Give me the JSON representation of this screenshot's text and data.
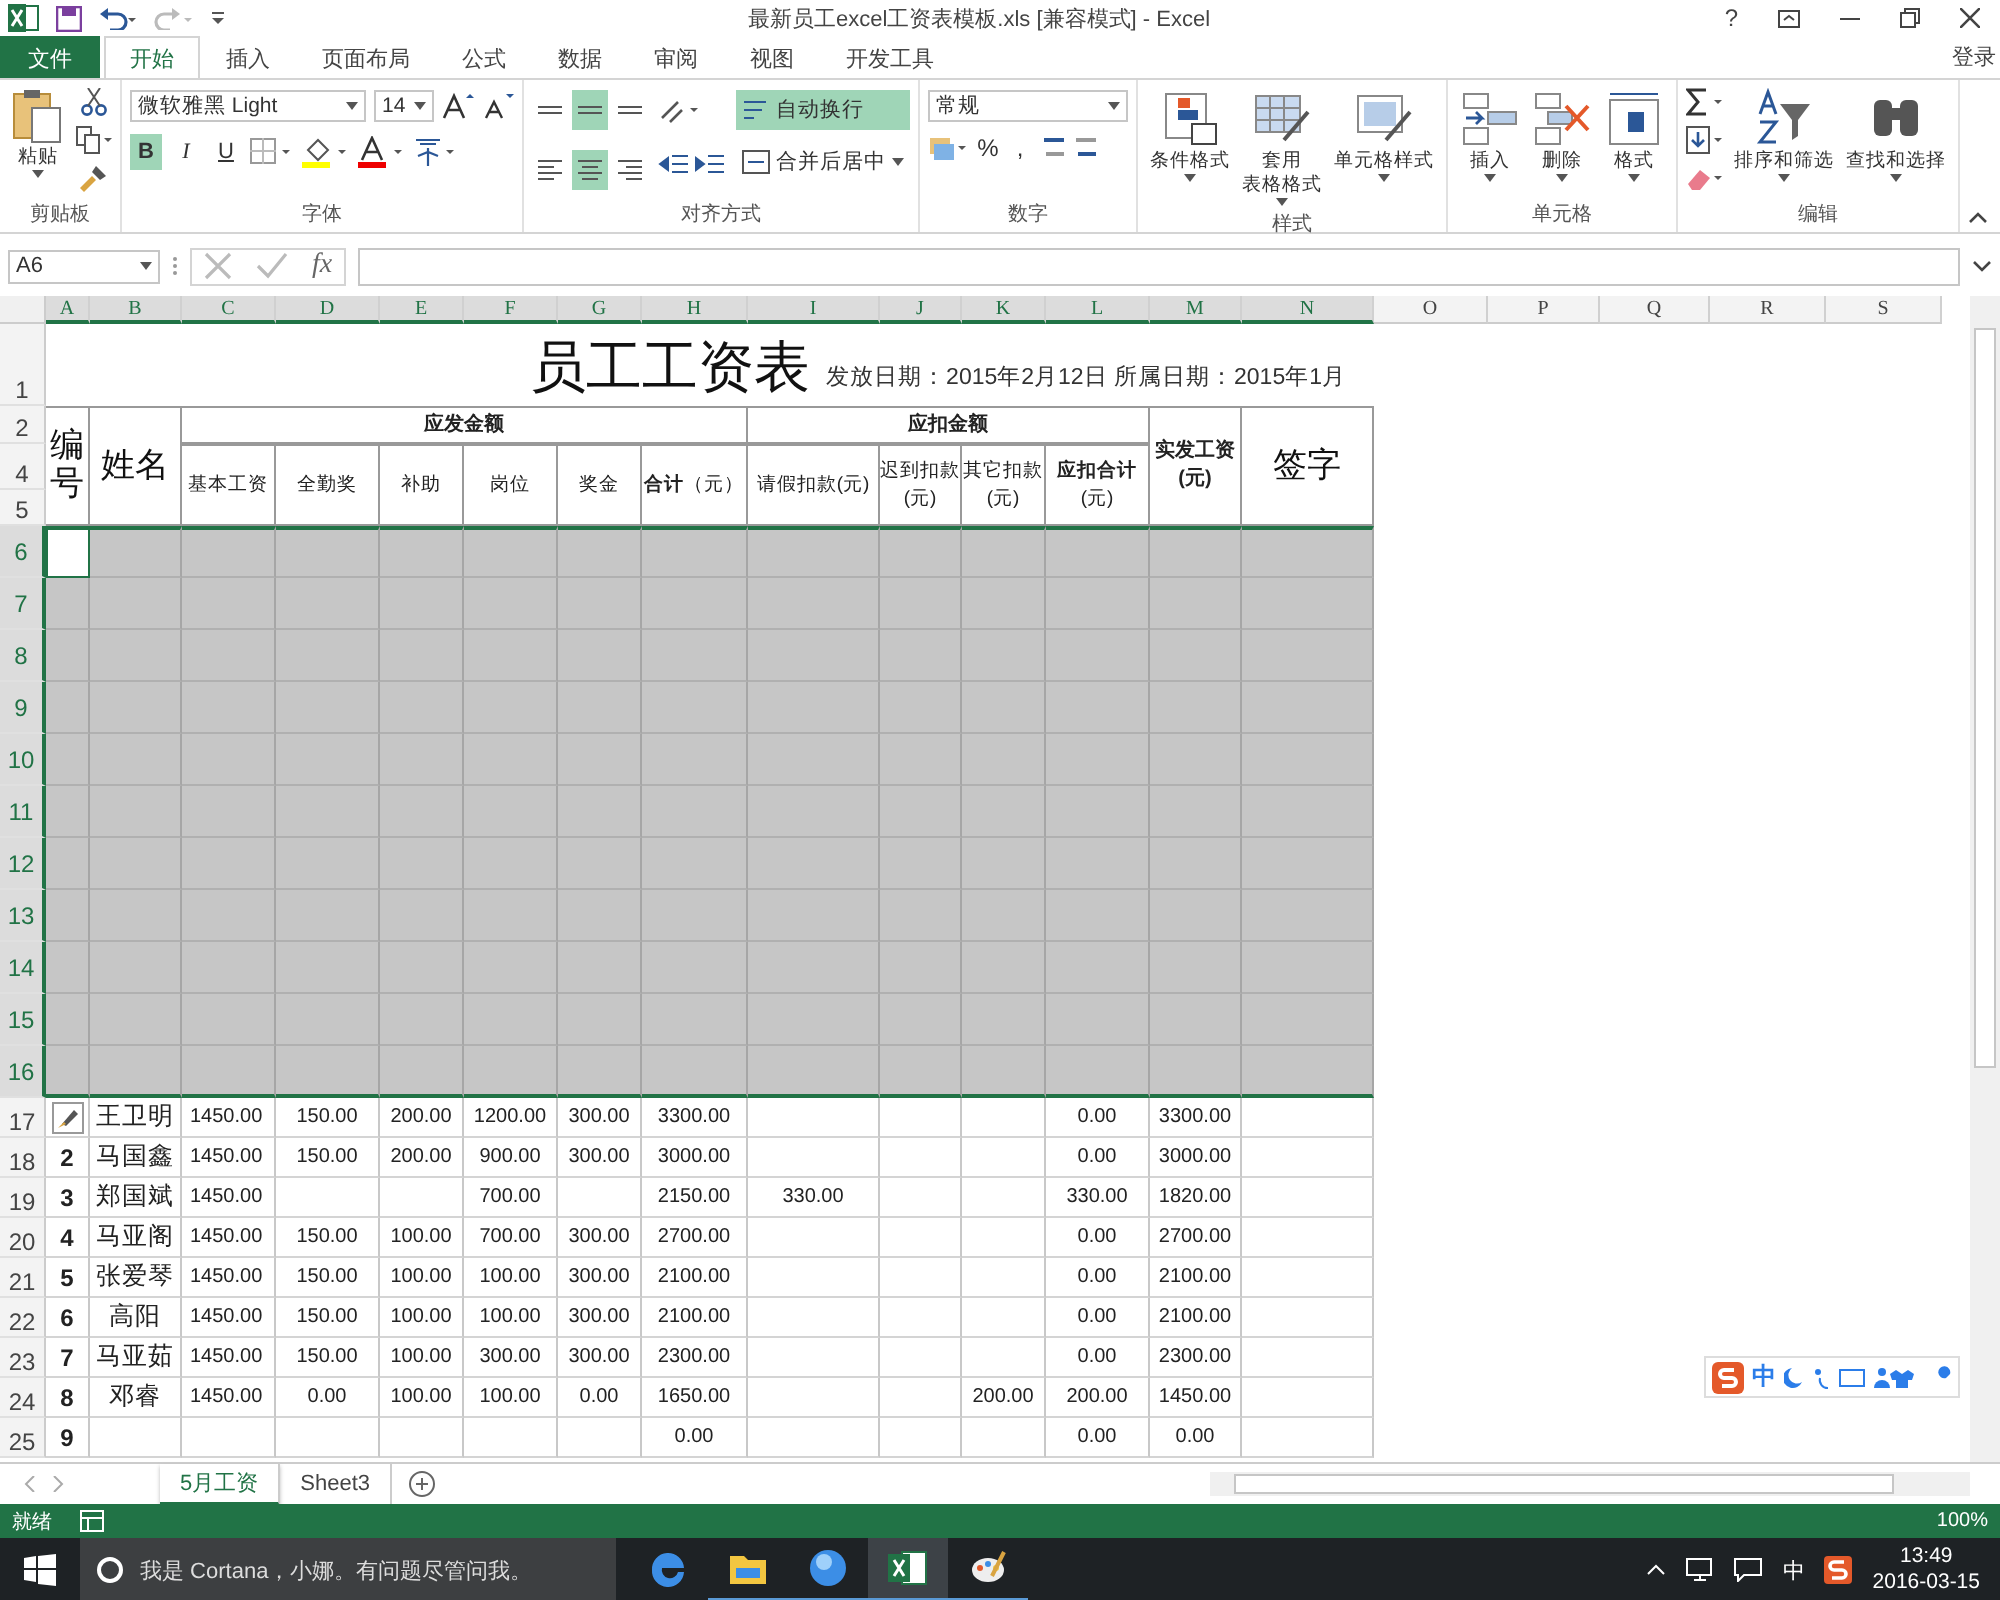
{
  "title_bar": {
    "title": "最新员工excel工资表模板.xls  [兼容模式] - Excel",
    "help": "?"
  },
  "tabs": [
    {
      "label": "文件",
      "kind": "file",
      "selected": false
    },
    {
      "label": "开始",
      "kind": "tab",
      "selected": true
    },
    {
      "label": "插入",
      "kind": "tab",
      "selected": false
    },
    {
      "label": "页面布局",
      "kind": "tab",
      "selected": false
    },
    {
      "label": "公式",
      "kind": "tab",
      "selected": false
    },
    {
      "label": "数据",
      "kind": "tab",
      "selected": false
    },
    {
      "label": "审阅",
      "kind": "tab",
      "selected": false
    },
    {
      "label": "视图",
      "kind": "tab",
      "selected": false
    },
    {
      "label": "开发工具",
      "kind": "tab",
      "selected": false
    }
  ],
  "account": "登录",
  "ribbon": {
    "clipboard": {
      "label": "剪贴板",
      "paste": "粘贴"
    },
    "font": {
      "label": "字体",
      "font_name": "微软雅黑 Light",
      "font_size": "14",
      "styles": [
        {
          "label": "B",
          "kind": "bold",
          "selected": true
        },
        {
          "label": "I",
          "kind": "italic",
          "selected": false
        },
        {
          "label": "U",
          "kind": "underline",
          "selected": false
        }
      ]
    },
    "alignment": {
      "label": "对齐方式",
      "align_buttons": [
        {
          "kind": "top",
          "selected": false
        },
        {
          "kind": "middle",
          "selected": true
        },
        {
          "kind": "bottom",
          "selected": false
        },
        {
          "kind": "left",
          "selected": false
        },
        {
          "kind": "center",
          "selected": true
        },
        {
          "kind": "right",
          "selected": false
        }
      ],
      "wrap_text": {
        "label": "自动换行",
        "selected": true
      },
      "merge": "合并后居中"
    },
    "number": {
      "label": "数字",
      "format": "常规",
      "percent": "%",
      "comma": ","
    },
    "styles": {
      "label": "样式",
      "buttons": [
        {
          "kind": "conditional",
          "lines": [
            "条件格式"
          ]
        },
        {
          "kind": "table",
          "lines": [
            "套用",
            "表格格式"
          ]
        },
        {
          "kind": "cellstyle",
          "lines": [
            "单元格样式"
          ]
        }
      ]
    },
    "cells": {
      "label": "单元格",
      "buttons": [
        {
          "kind": "insert",
          "lines": [
            "插入"
          ]
        },
        {
          "kind": "delete",
          "lines": [
            "删除"
          ]
        },
        {
          "kind": "format",
          "lines": [
            "格式"
          ]
        }
      ]
    },
    "editing": {
      "label": "编辑",
      "buttons": [
        {
          "kind": "sort",
          "lines": [
            "排序和筛选"
          ]
        },
        {
          "kind": "find",
          "lines": [
            "查找和选择"
          ]
        }
      ]
    }
  },
  "formula_bar": {
    "name_box": "A6",
    "fx": "fx"
  },
  "sheet": {
    "columns": [
      {
        "label": "A",
        "selected": true
      },
      {
        "label": "B",
        "selected": true
      },
      {
        "label": "C",
        "selected": true
      },
      {
        "label": "D",
        "selected": true
      },
      {
        "label": "E",
        "selected": true
      },
      {
        "label": "F",
        "selected": true
      },
      {
        "label": "G",
        "selected": true
      },
      {
        "label": "H",
        "selected": true
      },
      {
        "label": "I",
        "selected": true
      },
      {
        "label": "J",
        "selected": true
      },
      {
        "label": "K",
        "selected": true
      },
      {
        "label": "L",
        "selected": true
      },
      {
        "label": "M",
        "selected": true
      },
      {
        "label": "N",
        "selected": true
      },
      {
        "label": "O",
        "selected": false
      },
      {
        "label": "P",
        "selected": false
      },
      {
        "label": "Q",
        "selected": false
      },
      {
        "label": "R",
        "selected": false
      },
      {
        "label": "S",
        "selected": false
      }
    ],
    "title": "员工工资表",
    "subtitle": "发放日期：2015年2月12日 所属日期：2015年1月",
    "header_rows": [
      {
        "label": "1",
        "selected": false
      },
      {
        "label": "2",
        "selected": false
      },
      {
        "label": "4",
        "selected": false
      },
      {
        "label": "5",
        "selected": false
      }
    ],
    "header": {
      "id": "编号",
      "name": "姓名",
      "payable": "应发金额",
      "payable_columns": [
        "基本工资",
        "全勤奖",
        "补助",
        "岗位",
        "奖金",
        "**合计**（元）"
      ],
      "deduct": "应扣金额",
      "deduct_columns": [
        "请假扣款(元)",
        "迟到扣款(元)",
        "其它扣款(元)",
        "**应扣合计**(元)"
      ],
      "net": "实发工资(元)",
      "sign": "签字"
    },
    "blank_rows": [
      {
        "label": "6",
        "selected": true
      },
      {
        "label": "7",
        "selected": true
      },
      {
        "label": "8",
        "selected": true
      },
      {
        "label": "9",
        "selected": true
      },
      {
        "label": "10",
        "selected": true
      },
      {
        "label": "11",
        "selected": true
      },
      {
        "label": "12",
        "selected": true
      },
      {
        "label": "13",
        "selected": true
      },
      {
        "label": "14",
        "selected": true
      },
      {
        "label": "15",
        "selected": true
      },
      {
        "label": "16",
        "selected": true
      }
    ],
    "data_rows": [
      {
        "row": "17",
        "paste_options": true,
        "name": "王卫明",
        "cells": {
          "C": "1450.00",
          "D": "150.00",
          "E": "200.00",
          "F": "1200.00",
          "G": "300.00",
          "H": "3300.00",
          "L": "0.00",
          "M": "3300.00"
        }
      },
      {
        "row": "18",
        "no": "2",
        "name": "马国鑫",
        "cells": {
          "C": "1450.00",
          "D": "150.00",
          "E": "200.00",
          "F": "900.00",
          "G": "300.00",
          "H": "3000.00",
          "L": "0.00",
          "M": "3000.00"
        }
      },
      {
        "row": "19",
        "no": "3",
        "name": "郑国斌",
        "cells": {
          "C": "1450.00",
          "F": "700.00",
          "H": "2150.00",
          "I": "330.00",
          "L": "330.00",
          "M": "1820.00"
        }
      },
      {
        "row": "20",
        "no": "4",
        "name": "马亚阁",
        "cells": {
          "C": "1450.00",
          "D": "150.00",
          "E": "100.00",
          "F": "700.00",
          "G": "300.00",
          "H": "2700.00",
          "L": "0.00",
          "M": "2700.00"
        }
      },
      {
        "row": "21",
        "no": "5",
        "name": "张爱琴",
        "cells": {
          "C": "1450.00",
          "D": "150.00",
          "E": "100.00",
          "F": "100.00",
          "G": "300.00",
          "H": "2100.00",
          "L": "0.00",
          "M": "2100.00"
        }
      },
      {
        "row": "22",
        "no": "6",
        "name": "高阳",
        "cells": {
          "C": "1450.00",
          "D": "150.00",
          "E": "100.00",
          "F": "100.00",
          "G": "300.00",
          "H": "2100.00",
          "L": "0.00",
          "M": "2100.00"
        }
      },
      {
        "row": "23",
        "no": "7",
        "name": "马亚茹",
        "cells": {
          "C": "1450.00",
          "D": "150.00",
          "E": "100.00",
          "F": "300.00",
          "G": "300.00",
          "H": "2300.00",
          "L": "0.00",
          "M": "2300.00"
        }
      },
      {
        "row": "24",
        "no": "8",
        "name": "邓睿",
        "cells": {
          "C": "1450.00",
          "D": "0.00",
          "E": "100.00",
          "F": "100.00",
          "G": "0.00",
          "H": "1650.00",
          "K": "200.00",
          "L": "200.00",
          "M": "1450.00"
        }
      },
      {
        "row": "25",
        "no": "9",
        "cells": {
          "H": "0.00",
          "L": "0.00",
          "M": "0.00"
        }
      }
    ]
  },
  "sheet_tabs": [
    {
      "label": "5月工资",
      "selected": true
    },
    {
      "label": "Sheet3",
      "selected": false
    }
  ],
  "status_bar": {
    "status": "就绪",
    "zoom": "100%"
  },
  "ime_toolbar": {
    "mode": "中"
  },
  "taskbar": {
    "search": "我是 Cortana，小娜。有问题尽管问我。",
    "input_mode": "中",
    "time": "13:49",
    "date": "2016-03-15"
  }
}
